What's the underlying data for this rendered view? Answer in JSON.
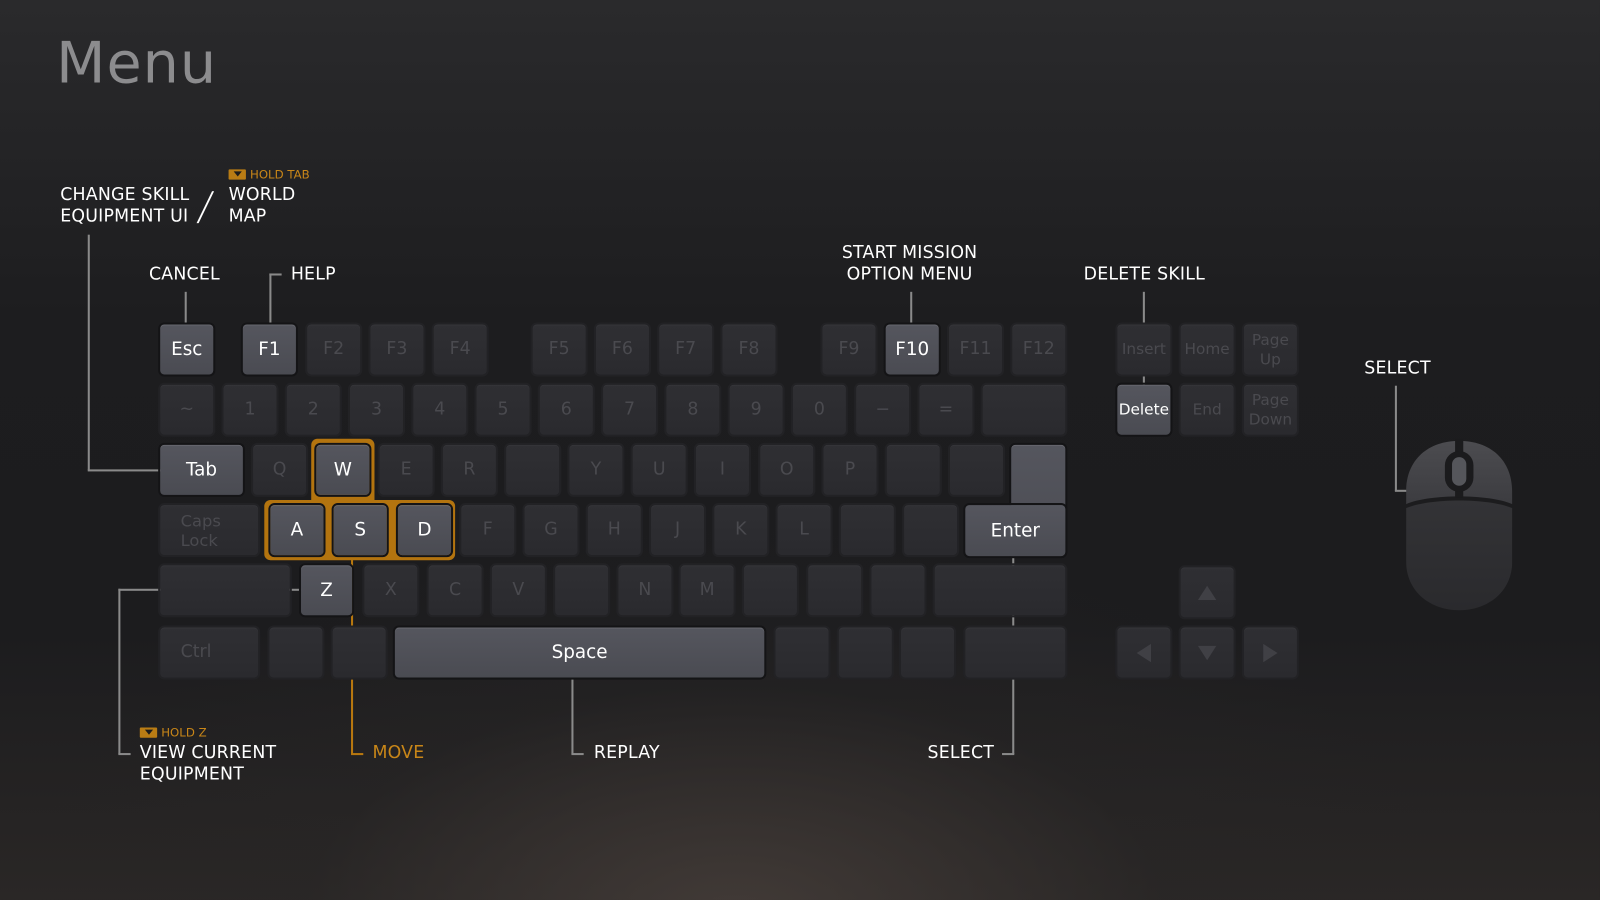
{
  "title": "Menu",
  "accent_color": "#c88618",
  "labels": {
    "change_skill": [
      "CHANGE SKILL",
      "EQUIPMENT UI"
    ],
    "hold_tab": "HOLD TAB",
    "world_map": [
      "WORLD",
      "MAP"
    ],
    "cancel": "CANCEL",
    "help": "HELP",
    "start_mission": [
      "START MISSION",
      "OPTION MENU"
    ],
    "delete_skill": "DELETE SKILL",
    "select_mouse": "SELECT",
    "hold_z": "HOLD Z",
    "view_equipment": [
      "VIEW CURRENT",
      "EQUIPMENT"
    ],
    "move": "MOVE",
    "replay": "REPLAY",
    "select_enter": "SELECT"
  },
  "keys": {
    "esc": "Esc",
    "f1": "F1",
    "f2": "F2",
    "f3": "F3",
    "f4": "F4",
    "f5": "F5",
    "f6": "F6",
    "f7": "F7",
    "f8": "F8",
    "f9": "F9",
    "f10": "F10",
    "f11": "F11",
    "f12": "F12",
    "insert": "Insert",
    "home": "Home",
    "page_up": [
      "Page",
      "Up"
    ],
    "tilde": "~",
    "n1": "1",
    "n2": "2",
    "n3": "3",
    "n4": "4",
    "n5": "5",
    "n6": "6",
    "n7": "7",
    "n8": "8",
    "n9": "9",
    "n0": "0",
    "minus": "−",
    "equals": "=",
    "delete": "Delete",
    "end": "End",
    "page_down": [
      "Page",
      "Down"
    ],
    "tab": "Tab",
    "q": "Q",
    "w": "W",
    "e": "E",
    "r": "R",
    "y": "Y",
    "u": "U",
    "i": "I",
    "o": "O",
    "p": "P",
    "caps": [
      "Caps",
      "Lock"
    ],
    "a": "A",
    "s": "S",
    "d": "D",
    "f": "F",
    "g": "G",
    "h": "H",
    "j": "J",
    "k": "K",
    "l": "L",
    "enter": "Enter",
    "z": "Z",
    "x": "X",
    "c": "C",
    "v": "V",
    "n": "N",
    "m": "M",
    "ctrl": "Ctrl",
    "space": "Space"
  },
  "active_keys": [
    "Esc",
    "F1",
    "F10",
    "Delete",
    "Tab",
    "W",
    "A",
    "S",
    "D",
    "Z",
    "Space",
    "Enter"
  ]
}
